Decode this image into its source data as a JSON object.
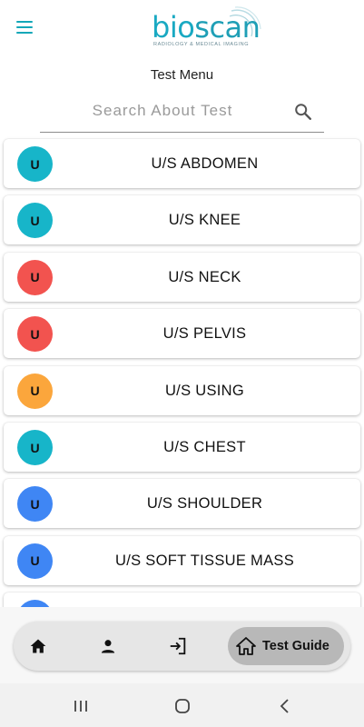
{
  "header": {
    "menu_icon": "hamburger-menu-icon",
    "logo": {
      "word_bio": "bio",
      "word_scan": "scan",
      "tagline": "RADIOLOGY & MEDICAL IMAGING"
    },
    "title": "Test Menu"
  },
  "search": {
    "placeholder": "Search About Test",
    "value": "",
    "icon": "search-icon"
  },
  "colors": {
    "accent": "#12a7b8",
    "teal": "#17b5c9",
    "red": "#f2534f",
    "orange": "#fba63c",
    "blue": "#3f86f4"
  },
  "tests": [
    {
      "initial": "U",
      "label": "U/S ABDOMEN",
      "color": "#17b5c9"
    },
    {
      "initial": "U",
      "label": "U/S KNEE",
      "color": "#17b5c9"
    },
    {
      "initial": "U",
      "label": "U/S NECK",
      "color": "#f2534f"
    },
    {
      "initial": "U",
      "label": "U/S PELVIS",
      "color": "#f2534f"
    },
    {
      "initial": "U",
      "label": "U/S USING",
      "color": "#fba63c"
    },
    {
      "initial": "U",
      "label": "U/S CHEST",
      "color": "#17b5c9"
    },
    {
      "initial": "U",
      "label": "U/S SHOULDER",
      "color": "#3f86f4"
    },
    {
      "initial": "U",
      "label": "U/S SOFT TISSUE MASS",
      "color": "#3f86f4"
    },
    {
      "initial": "U",
      "label": "",
      "color": "#3f86f4"
    }
  ],
  "bottom_nav": {
    "items": [
      {
        "name": "home-icon"
      },
      {
        "name": "person-icon"
      },
      {
        "name": "login-icon"
      }
    ],
    "active": {
      "icon": "house-outline-icon",
      "label": "Test Guide"
    }
  },
  "system_nav": [
    "recent-apps-icon",
    "home-circle-icon",
    "back-icon"
  ]
}
